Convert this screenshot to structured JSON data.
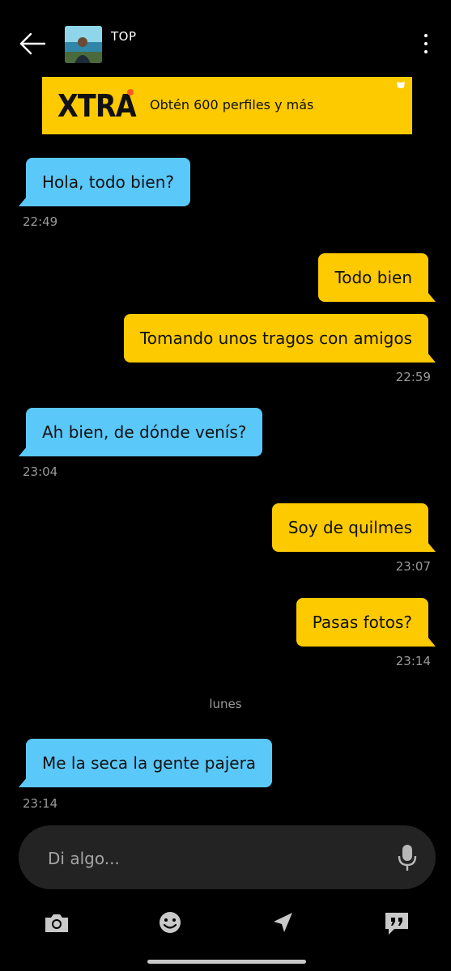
{
  "header": {
    "contact_name": "TOP"
  },
  "banner": {
    "logo_text": "XTRA",
    "promo_text": "Obtén 600 perfiles y más",
    "color": "#fdca00"
  },
  "messages": [
    {
      "direction": "in",
      "text": "Hola, todo bien?",
      "time": "22:49"
    },
    {
      "direction": "out",
      "text": "Todo bien",
      "time": ""
    },
    {
      "direction": "out",
      "text": "Tomando unos tragos con amigos",
      "time": "22:59"
    },
    {
      "direction": "in",
      "text": "Ah bien, de dónde venís?",
      "time": "23:04"
    },
    {
      "direction": "out",
      "text": "Soy de quilmes",
      "time": "23:07"
    },
    {
      "direction": "out",
      "text": "Pasas fotos?",
      "time": "23:14"
    },
    {
      "direction": "in",
      "text": "Me la seca la gente pajera",
      "time": "23:14"
    }
  ],
  "day_separator": "lunes",
  "composer": {
    "placeholder": "Di algo..."
  },
  "colors": {
    "incoming_bubble": "#5bc8fa",
    "outgoing_bubble": "#fdca00",
    "background": "#000000",
    "composer": "#232323"
  },
  "toolbar": {
    "icons": [
      "camera-icon",
      "emoji-icon",
      "location-icon",
      "saved-phrases-icon"
    ]
  }
}
